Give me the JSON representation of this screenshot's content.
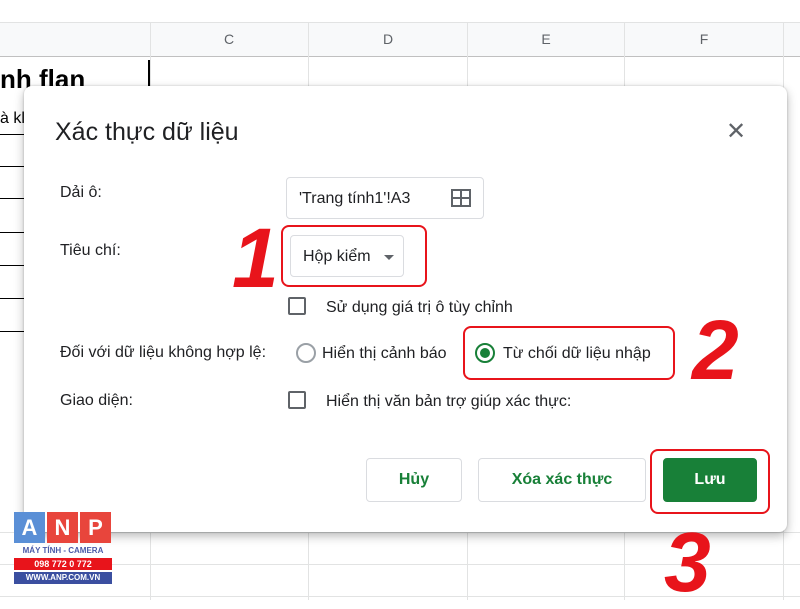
{
  "sheet": {
    "columns": [
      "C",
      "D",
      "E",
      "F"
    ],
    "cell_bold_text": "nh flan",
    "cell_text": "à kl"
  },
  "dialog": {
    "title": "Xác thực dữ liệu",
    "close_icon": "close-icon",
    "range_label": "Dải ô:",
    "range_value": "'Trang tính1'!A3",
    "range_icon": "grid-icon",
    "criteria_label": "Tiêu chí:",
    "criteria_value": "Hộp kiểm",
    "custom_values_label": "Sử dụng giá trị ô tùy chỉnh",
    "invalid_label": "Đối với dữ liệu không hợp lệ:",
    "invalid_options": [
      {
        "label": "Hiển thị cảnh báo",
        "selected": false
      },
      {
        "label": "Từ chối dữ liệu nhập",
        "selected": true
      }
    ],
    "appearance_label": "Giao diện:",
    "help_text_label": "Hiển thị văn bản trợ giúp xác thực:",
    "buttons": {
      "cancel": "Hủy",
      "remove": "Xóa xác thực",
      "save": "Lưu"
    }
  },
  "annotations": {
    "step1": "1",
    "step2": "2",
    "step3": "3"
  },
  "logo": {
    "letters": [
      "A",
      "N",
      "P"
    ],
    "line1": "MÁY TÍNH - CAMERA",
    "line2": "098 772 0 772",
    "line3": "WWW.ANP.COM.VN"
  },
  "colors": {
    "accent_green": "#188038",
    "annotation_red": "#e8141b"
  }
}
